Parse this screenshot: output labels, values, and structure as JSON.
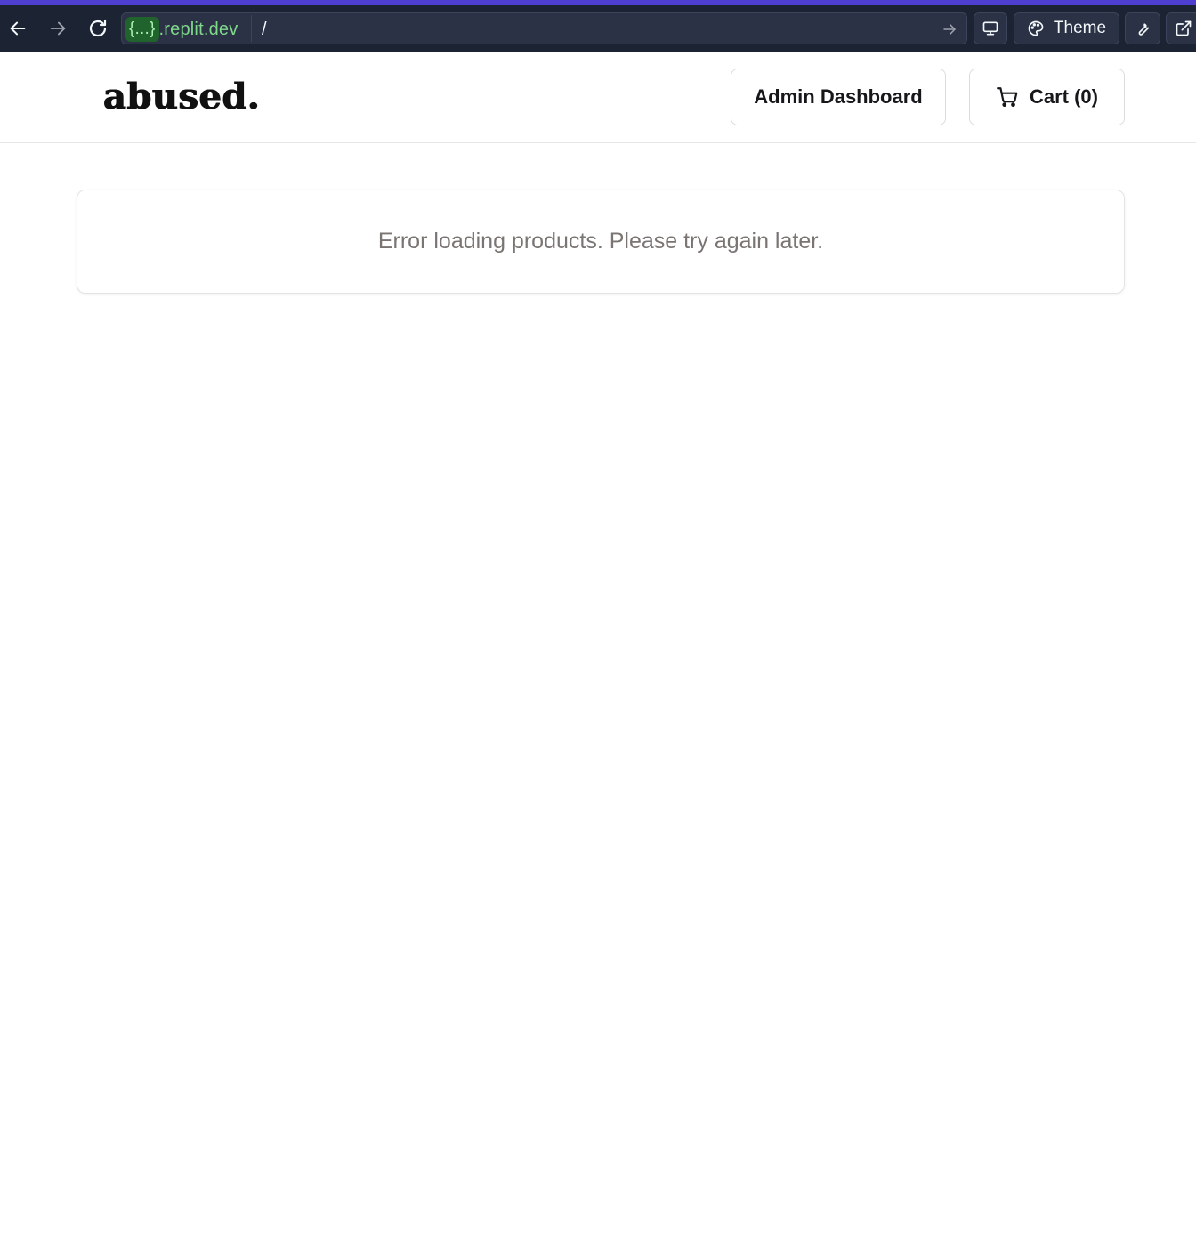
{
  "browser": {
    "url_host_redacted": "{...}",
    "url_host_suffix": ".replit.dev",
    "url_path": "/",
    "theme_label": "Theme",
    "icons": {
      "back": "arrow-left-icon",
      "forward": "arrow-right-icon",
      "reload": "reload-icon",
      "go": "arrow-right-icon",
      "device": "monitor-icon",
      "theme": "palette-icon",
      "devtools": "wrench-icon",
      "external": "external-link-icon"
    },
    "colors": {
      "background": "#1c2333",
      "accent": "#4f3fd1",
      "host_text": "#7fd88a"
    }
  },
  "header": {
    "logo_text": "abused.",
    "admin_button_label": "Admin Dashboard",
    "cart_button_label": "Cart (0)",
    "cart_icon": "shopping-cart-icon"
  },
  "main": {
    "error_message": "Error loading products. Please try again later."
  }
}
